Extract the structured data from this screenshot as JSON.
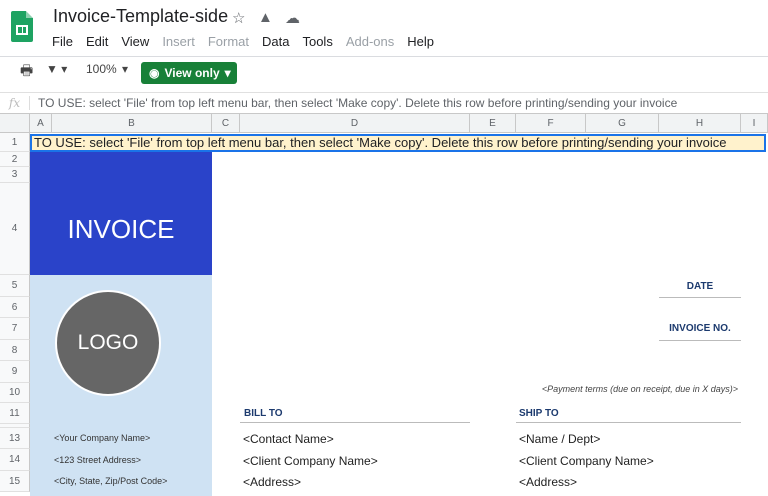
{
  "doc": {
    "title": "Invoice-Template-side"
  },
  "menu": [
    {
      "label": "File",
      "disabled": false
    },
    {
      "label": "Edit",
      "disabled": false
    },
    {
      "label": "View",
      "disabled": false
    },
    {
      "label": "Insert",
      "disabled": true
    },
    {
      "label": "Format",
      "disabled": true
    },
    {
      "label": "Data",
      "disabled": false
    },
    {
      "label": "Tools",
      "disabled": false
    },
    {
      "label": "Add-ons",
      "disabled": true
    },
    {
      "label": "Help",
      "disabled": false
    }
  ],
  "toolbar": {
    "zoom": "100%",
    "view_only": "View only"
  },
  "formula": {
    "fx": "fx",
    "value": "TO USE: select 'File' from top left menu bar, then select 'Make copy'. Delete this row before printing/sending your invoice"
  },
  "columns": [
    "A",
    "B",
    "C",
    "D",
    "E",
    "F",
    "G",
    "H",
    "I"
  ],
  "rows": [
    "1",
    "2",
    "3",
    "4",
    "5",
    "6",
    "7",
    "8",
    "9",
    "10",
    "11",
    "",
    "13",
    "14",
    "15"
  ],
  "sheet": {
    "note": "TO USE: select 'File' from top left menu bar, then select 'Make copy'. Delete this row before printing/sending your invoice",
    "invoice": "INVOICE",
    "logo": "LOGO",
    "date": "DATE",
    "invoice_no": "INVOICE NO.",
    "payment_terms": "<Payment terms (due on receipt, due in X days)>",
    "bill_to": "BILL TO",
    "ship_to": "SHIP TO",
    "company": [
      "<Your Company Name>",
      "<123 Street Address>",
      "<City, State, Zip/Post Code>"
    ],
    "bill": [
      "<Contact Name>",
      "<Client Company Name>",
      "<Address>"
    ],
    "ship": [
      "<Name / Dept>",
      "<Client Company Name>",
      "<Address>"
    ]
  },
  "colors": {
    "invoice_block": "#2a43c9",
    "side_panel": "#cfe2f3",
    "note_bg": "#fff2cc",
    "accent_green": "#188038"
  }
}
